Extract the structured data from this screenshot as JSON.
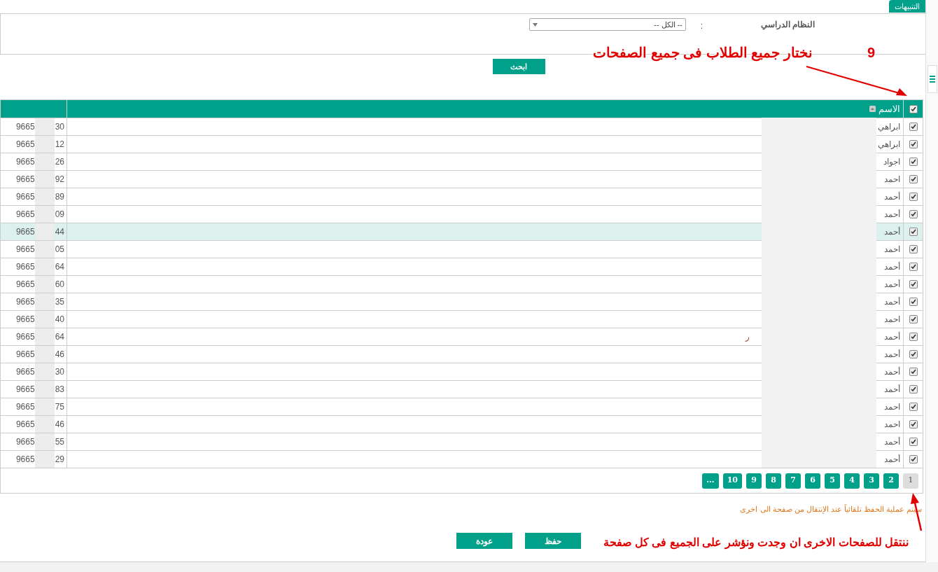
{
  "notifications_tab": {
    "label": "التنبيهات"
  },
  "filter": {
    "label": "النظام الدراسي",
    "colon": ":",
    "select_value": "-- الكل --"
  },
  "search_button": "ابحث",
  "annotation_top": {
    "number": "9",
    "text": "نختار جميع الطلاب فى جميع الصفحات"
  },
  "table": {
    "select_all_checked": true,
    "columns": [
      "الاسم"
    ],
    "rows": [
      {
        "name": "ابراهي",
        "phone_start": "9665",
        "phone_end": "30",
        "checked": true,
        "selected": false
      },
      {
        "name": "ابراهي",
        "phone_start": "9665",
        "phone_end": "12",
        "checked": true,
        "selected": false
      },
      {
        "name": "اجواد",
        "phone_start": "9665",
        "phone_end": "26",
        "checked": true,
        "selected": false
      },
      {
        "name": "احمد",
        "phone_start": "9665",
        "phone_end": "92",
        "checked": true,
        "selected": false
      },
      {
        "name": "أحمد",
        "phone_start": "9665",
        "phone_end": "89",
        "checked": true,
        "selected": false
      },
      {
        "name": "أحمد",
        "phone_start": "9665",
        "phone_end": "09",
        "checked": true,
        "selected": false
      },
      {
        "name": "أحمد",
        "phone_start": "9665",
        "phone_end": "44",
        "checked": true,
        "selected": true
      },
      {
        "name": "احمد",
        "phone_start": "9665",
        "phone_end": "05",
        "checked": true,
        "selected": false
      },
      {
        "name": "أحمد",
        "phone_start": "9665",
        "phone_end": "64",
        "checked": true,
        "selected": false
      },
      {
        "name": "أحمد",
        "phone_start": "9665",
        "phone_end": "60",
        "checked": true,
        "selected": false
      },
      {
        "name": "أحمد",
        "phone_start": "9665",
        "phone_end": "35",
        "checked": true,
        "selected": false
      },
      {
        "name": "احمد",
        "phone_start": "9665",
        "phone_end": "40",
        "checked": true,
        "selected": false
      },
      {
        "name": "أحمد",
        "name_tail": "ر",
        "phone_start": "9665",
        "phone_end": "64",
        "checked": true,
        "selected": false
      },
      {
        "name": "أحمد",
        "phone_start": "9665",
        "phone_end": "46",
        "checked": true,
        "selected": false
      },
      {
        "name": "أحمد",
        "phone_start": "9665",
        "phone_end": "30",
        "checked": true,
        "selected": false
      },
      {
        "name": "أحمد",
        "phone_start": "9665",
        "phone_end": "83",
        "checked": true,
        "selected": false
      },
      {
        "name": "احمد",
        "phone_start": "9665",
        "phone_end": "75",
        "checked": true,
        "selected": false
      },
      {
        "name": "احمد",
        "phone_start": "9665",
        "phone_end": "46",
        "checked": true,
        "selected": false
      },
      {
        "name": "أحمد",
        "phone_start": "9665",
        "phone_end": "55",
        "checked": true,
        "selected": false
      },
      {
        "name": "أحمد",
        "phone_start": "9665",
        "phone_end": "29",
        "checked": true,
        "selected": false
      }
    ]
  },
  "pagination": [
    {
      "label": "1",
      "selected": true
    },
    {
      "label": "2",
      "selected": false
    },
    {
      "label": "3",
      "selected": false
    },
    {
      "label": "4",
      "selected": false
    },
    {
      "label": "5",
      "selected": false
    },
    {
      "label": "6",
      "selected": false
    },
    {
      "label": "7",
      "selected": false
    },
    {
      "label": "8",
      "selected": false
    },
    {
      "label": "9",
      "selected": false
    },
    {
      "label": "10",
      "selected": false
    },
    {
      "label": "...",
      "selected": false
    }
  ],
  "autosave_note": "سيتم عملية الحفظ تلقائياً عند الإنتقال من صفحة الى اخرى",
  "buttons": [
    "حفظ",
    "عودة"
  ],
  "annotation_bottom": {
    "text": "ننتقل للصفحات الاخرى ان وجدت ونؤشر على الجميع فى كل صفحة"
  }
}
